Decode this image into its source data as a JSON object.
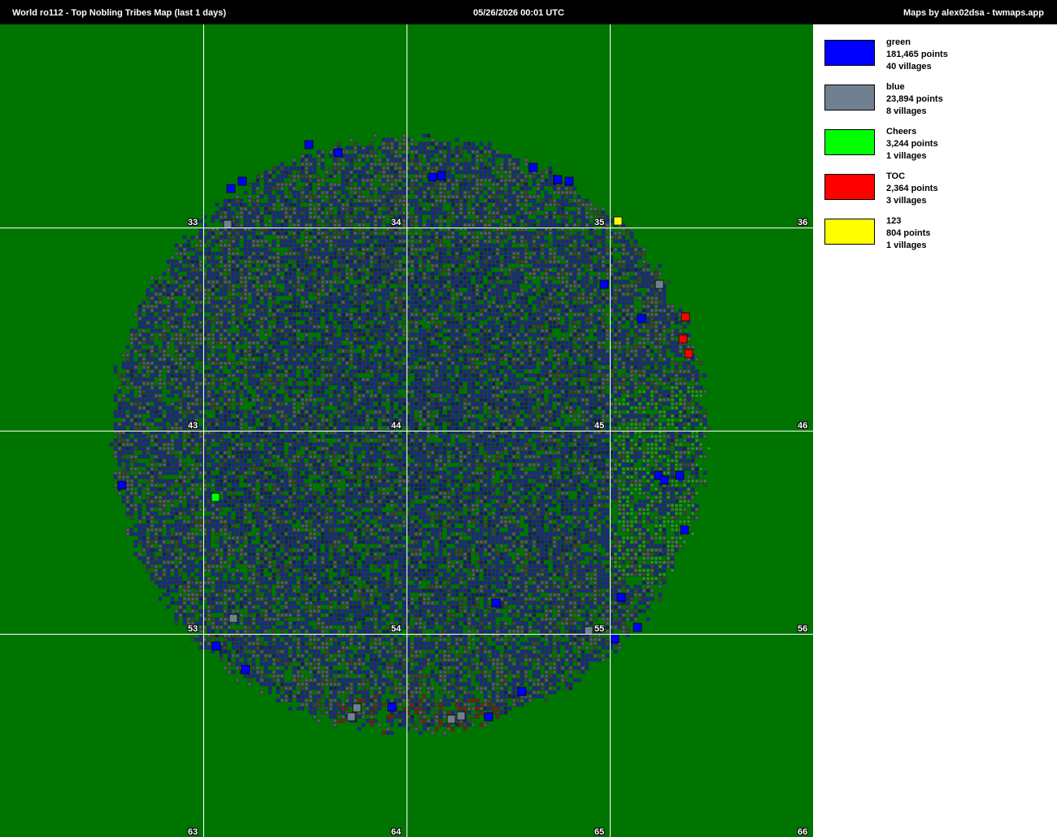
{
  "header": {
    "title": "World ro112  -  Top Nobling Tribes Map (last 1 days)",
    "date": "05/26/2026 00:01 UTC",
    "credit": "Maps by alex02dsa - twmaps.app"
  },
  "map": {
    "background_color": "#007400",
    "barbarian_color": "#555555",
    "continent_labels": [
      "33",
      "34",
      "35",
      "36",
      "43",
      "44",
      "45",
      "46",
      "53",
      "54",
      "55",
      "56",
      "63",
      "64",
      "65",
      "66"
    ]
  },
  "legend": [
    {
      "name": "green",
      "points": "181,465 points",
      "villages": "40 villages",
      "color": "#0000ff"
    },
    {
      "name": "blue",
      "points": "23,894 points",
      "villages": "8 villages",
      "color": "#708090"
    },
    {
      "name": "Cheers",
      "points": "3,244 points",
      "villages": "1 villages",
      "color": "#00ff00"
    },
    {
      "name": "TOC",
      "points": "2,364 points",
      "villages": "3 villages",
      "color": "#ff0000"
    },
    {
      "name": "123",
      "points": "804 points",
      "villages": "1 villages",
      "color": "#ffff00"
    }
  ]
}
